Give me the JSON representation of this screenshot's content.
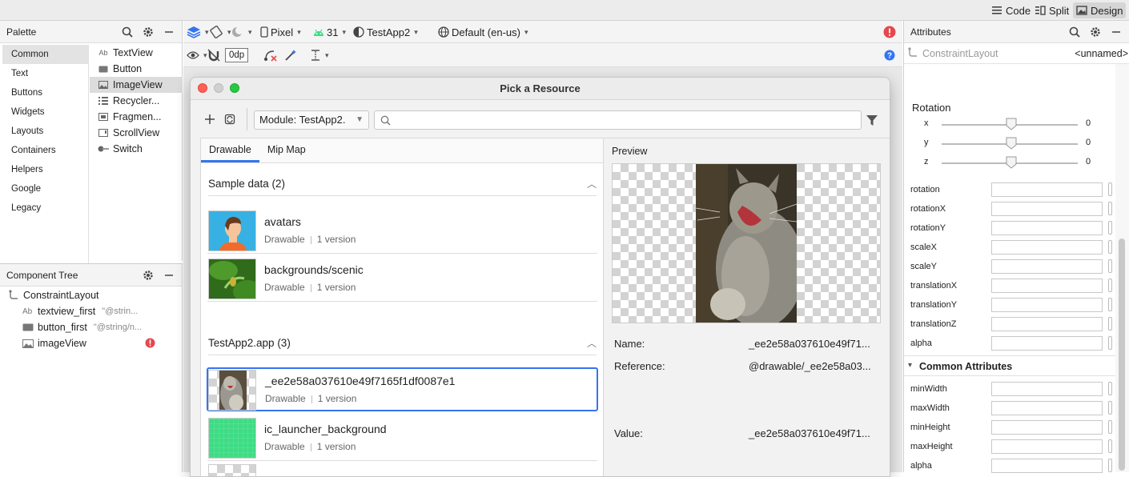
{
  "top_bar": {
    "code_label": "Code",
    "split_label": "Split",
    "design_label": "Design"
  },
  "palette": {
    "title": "Palette",
    "categories": [
      "Common",
      "Text",
      "Buttons",
      "Widgets",
      "Layouts",
      "Containers",
      "Helpers",
      "Google",
      "Legacy"
    ],
    "selected_category": "Common",
    "items": [
      {
        "icon": "Ab",
        "label": "TextView"
      },
      {
        "icon": "button-icon",
        "label": "Button"
      },
      {
        "icon": "image-icon",
        "label": "ImageView"
      },
      {
        "icon": "list-icon",
        "label": "Recycler..."
      },
      {
        "icon": "fragment-icon",
        "label": "Fragmen..."
      },
      {
        "icon": "scroll-icon",
        "label": "ScrollView"
      },
      {
        "icon": "switch-icon",
        "label": "Switch"
      }
    ],
    "selected_item": "ImageView"
  },
  "component_tree": {
    "title": "Component Tree",
    "root": "ConstraintLayout",
    "children": [
      {
        "icon": "Ab",
        "name": "textview_first",
        "value": "\"@strin..."
      },
      {
        "icon": "button-icon",
        "name": "button_first",
        "value": "\"@string/n..."
      },
      {
        "icon": "image-icon",
        "name": "imageView",
        "value": ""
      }
    ]
  },
  "toolbar": {
    "device": "Pixel",
    "api": "31",
    "theme": "TestApp2",
    "locale": "Default (en-us)",
    "margin": "0dp"
  },
  "dialog": {
    "title": "Pick a Resource",
    "module": "Module: TestApp2.",
    "search_placeholder": "",
    "tabs": [
      "Drawable",
      "Mip Map"
    ],
    "active_tab": "Drawable",
    "sections": [
      {
        "title": "Sample data (2)",
        "resources": [
          {
            "name": "avatars",
            "type": "Drawable",
            "versions": "1 version"
          },
          {
            "name": "backgrounds/scenic",
            "type": "Drawable",
            "versions": "1 version"
          }
        ]
      },
      {
        "title": "TestApp2.app (3)",
        "resources": [
          {
            "name": "_ee2e58a037610e49f7165f1df0087e1",
            "type": "Drawable",
            "versions": "1 version"
          },
          {
            "name": "ic_launcher_background",
            "type": "Drawable",
            "versions": "1 version"
          }
        ]
      }
    ],
    "preview": {
      "title": "Preview",
      "name_label": "Name:",
      "name_value": "_ee2e58a037610e49f71...",
      "reference_label": "Reference:",
      "reference_value": "@drawable/_ee2e58a03...",
      "value_label": "Value:",
      "value_value": "_ee2e58a037610e49f71..."
    }
  },
  "attributes": {
    "title": "Attributes",
    "component": "ConstraintLayout",
    "component_id": "<unnamed>",
    "rotation_title": "Rotation",
    "rotation": [
      {
        "axis": "x",
        "value": "0"
      },
      {
        "axis": "y",
        "value": "0"
      },
      {
        "axis": "z",
        "value": "0"
      }
    ],
    "fields": [
      "rotation",
      "rotationX",
      "rotationY",
      "scaleX",
      "scaleY",
      "translationX",
      "translationY",
      "translationZ",
      "alpha"
    ],
    "common_title": "Common Attributes",
    "common_fields": [
      "minWidth",
      "maxWidth",
      "minHeight",
      "maxHeight",
      "alpha"
    ]
  },
  "colors": {
    "accent": "#3574f0",
    "error": "#e5484d",
    "selection": "#dcdcdc"
  }
}
